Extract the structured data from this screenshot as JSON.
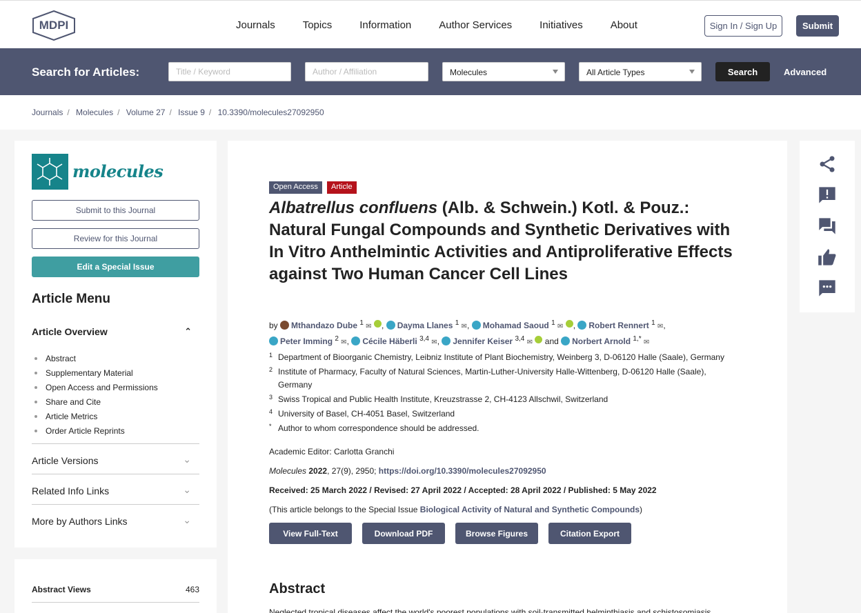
{
  "header": {
    "brand": "MDPI",
    "nav": [
      "Journals",
      "Topics",
      "Information",
      "Author Services",
      "Initiatives",
      "About"
    ],
    "sign_in": "Sign In / Sign Up",
    "submit": "Submit"
  },
  "search": {
    "label": "Search for Articles:",
    "title_placeholder": "Title / Keyword",
    "author_placeholder": "Author / Affiliation",
    "journal_value": "Molecules",
    "type_value": "All Article Types",
    "search_button": "Search",
    "advanced": "Advanced"
  },
  "breadcrumb": [
    "Journals",
    "Molecules",
    "Volume 27",
    "Issue 9",
    "10.3390/molecules27092950"
  ],
  "sidebar": {
    "journal_name": "molecules",
    "buttons": [
      "Submit to this Journal",
      "Review for this Journal",
      "Edit a Special Issue"
    ],
    "menu_title": "Article Menu",
    "overview_title": "Article Overview",
    "overview_items": [
      "Abstract",
      "Supplementary Material",
      "Open Access and Permissions",
      "Share and Cite",
      "Article Metrics",
      "Order Article Reprints"
    ],
    "sections": [
      "Article Versions",
      "Related Info Links",
      "More by Authors Links"
    ],
    "abstract_views_label": "Abstract Views",
    "abstract_views_value": "463"
  },
  "article": {
    "badge_open": "Open Access",
    "badge_type": "Article",
    "title_italic": "Albatrellus confluens",
    "title_rest": " (Alb. & Schwein.) Kotl. & Pouz.: Natural Fungal Compounds and Synthetic Derivatives with In Vitro Anthelmintic Activities and Antiproliferative Effects against Two Human Cancer Cell Lines",
    "by": "by",
    "authors": [
      {
        "name": "Mthandazo Dube",
        "sup": "1"
      },
      {
        "name": "Dayma Llanes",
        "sup": "1"
      },
      {
        "name": "Mohamad Saoud",
        "sup": "1"
      },
      {
        "name": "Robert Rennert",
        "sup": "1"
      },
      {
        "name": "Peter Imming",
        "sup": "2"
      },
      {
        "name": "Cécile Häberli",
        "sup": "3,4"
      },
      {
        "name": "Jennifer Keiser",
        "sup": "3,4"
      },
      {
        "name": "Norbert Arnold",
        "sup": "1,*"
      }
    ],
    "and": "and",
    "affiliations": [
      {
        "n": "1",
        "text": "Department of Bioorganic Chemistry, Leibniz Institute of Plant Biochemistry, Weinberg 3, D-06120 Halle (Saale), Germany"
      },
      {
        "n": "2",
        "text": "Institute of Pharmacy, Faculty of Natural Sciences, Martin-Luther-University Halle-Wittenberg, D-06120 Halle (Saale), Germany"
      },
      {
        "n": "3",
        "text": "Swiss Tropical and Public Health Institute, Kreuzstrasse 2, CH-4123 Allschwil, Switzerland"
      },
      {
        "n": "4",
        "text": "University of Basel, CH-4051 Basel, Switzerland"
      },
      {
        "n": "*",
        "text": "Author to whom correspondence should be addressed."
      }
    ],
    "editor": "Academic Editor: Carlotta Granchi",
    "citation_journal": "Molecules",
    "citation_year": "2022",
    "citation_rest": ", 27(9), 2950; ",
    "doi": "https://doi.org/10.3390/molecules27092950",
    "dates": "Received: 25 March 2022 / Revised: 27 April 2022 / Accepted: 28 April 2022 / Published: 5 May 2022",
    "special_prefix": "(This article belongs to the Special Issue ",
    "special_link": "Biological Activity of Natural and Synthetic Compounds",
    "special_suffix": ")",
    "actions": [
      "View Full-Text",
      "Download PDF",
      "Browse Figures",
      "Citation Export"
    ],
    "abstract_heading": "Abstract",
    "abstract_text": "Neglected tropical diseases affect the world's poorest populations with soil-transmitted helminthiasis and schistosomiasis"
  },
  "share": {
    "icons": [
      "share-icon",
      "report-icon",
      "comments-icon",
      "like-icon",
      "message-icon"
    ]
  }
}
